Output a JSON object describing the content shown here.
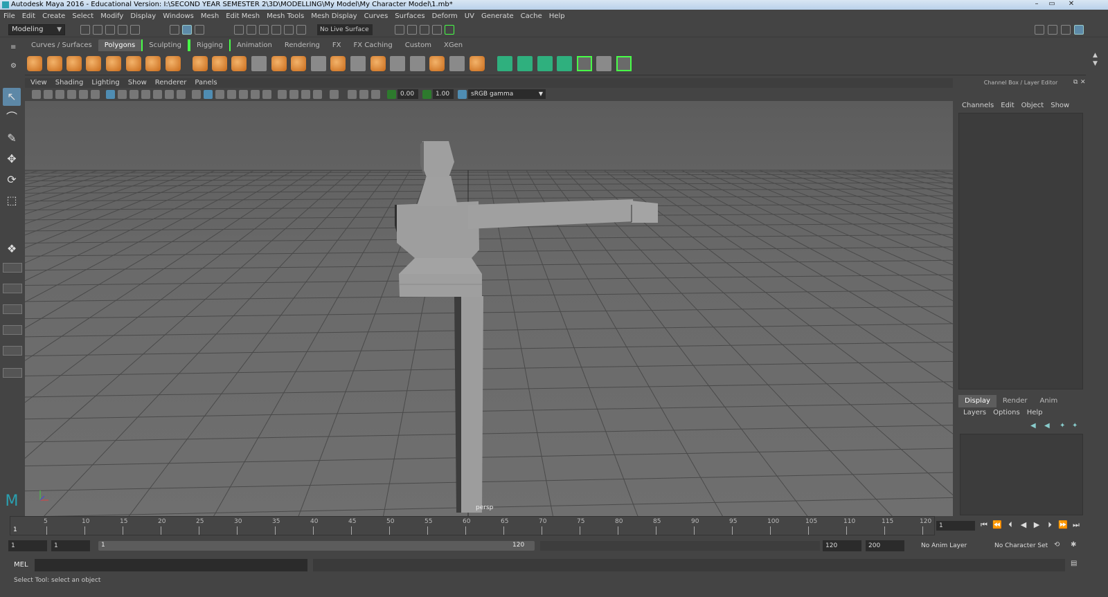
{
  "window": {
    "title": "Autodesk Maya 2016 - Educational Version: I:\\SECOND YEAR SEMESTER 2\\3D\\MODELLING\\My Model\\My Character Model\\1.mb*"
  },
  "menubar": [
    "File",
    "Edit",
    "Create",
    "Select",
    "Modify",
    "Display",
    "Windows",
    "Mesh",
    "Edit Mesh",
    "Mesh Tools",
    "Mesh Display",
    "Curves",
    "Surfaces",
    "Deform",
    "UV",
    "Generate",
    "Cache",
    "Help"
  ],
  "statusline": {
    "menuset": "Modeling",
    "live_surface": "No Live Surface"
  },
  "shelf": {
    "tabs": [
      "Curves / Surfaces",
      "Polygons",
      "Sculpting",
      "Rigging",
      "Animation",
      "Rendering",
      "FX",
      "FX Caching",
      "Custom",
      "XGen"
    ],
    "active_tab": "Polygons"
  },
  "panel": {
    "menu": [
      "View",
      "Shading",
      "Lighting",
      "Show",
      "Renderer",
      "Panels"
    ],
    "exposure": "0.00",
    "gamma": "1.00",
    "color_space": "sRGB gamma",
    "camera_label": "persp"
  },
  "channelbox": {
    "header": "Channel Box / Layer Editor",
    "menu": [
      "Channels",
      "Edit",
      "Object",
      "Show"
    ]
  },
  "layers": {
    "tabs": [
      "Display",
      "Render",
      "Anim"
    ],
    "active_tab": "Display",
    "menu": [
      "Layers",
      "Options",
      "Help"
    ]
  },
  "timeline": {
    "tick_labels": [
      "5",
      "10",
      "15",
      "20",
      "25",
      "30",
      "35",
      "40",
      "45",
      "50",
      "55",
      "60",
      "65",
      "70",
      "75",
      "80",
      "85",
      "90",
      "95",
      "100",
      "105",
      "110",
      "115",
      "120"
    ],
    "start_marker": "1",
    "current_frame": "1"
  },
  "range": {
    "start": "1",
    "playback_start": "1",
    "slider_start": "1",
    "slider_end": "120",
    "playback_end": "120",
    "end": "200",
    "anim_layer": "No Anim Layer",
    "character_set": "No Character Set"
  },
  "cmdline": {
    "label": "MEL"
  },
  "helpline": {
    "text": "Select Tool: select an object"
  }
}
